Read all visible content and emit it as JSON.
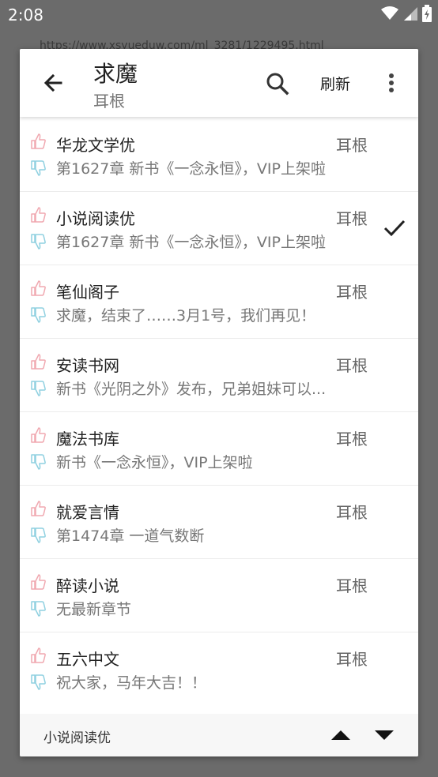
{
  "status_bar": {
    "time": "2:08"
  },
  "background_url": "https://www.xsyueduw.com/ml_3281/1229495.html",
  "toolbar": {
    "title": "求魔",
    "subtitle": "耳根",
    "refresh_label": "刷新",
    "icons": [
      "back-arrow-icon",
      "search-icon",
      "more-vert-icon"
    ]
  },
  "sources": [
    {
      "name": "华龙文学优",
      "author": "耳根",
      "latest": "第1627章 新书《一念永恒》，VIP上架啦",
      "selected": false
    },
    {
      "name": "小说阅读优",
      "author": "耳根",
      "latest": "第1627章 新书《一念永恒》，VIP上架啦",
      "selected": true
    },
    {
      "name": "笔仙阁子",
      "author": "耳根",
      "latest": "求魔，结束了……3月1号，我们再见！",
      "selected": false
    },
    {
      "name": "安读书网",
      "author": "耳根",
      "latest": "新书《光阴之外》发布，兄弟姐妹可以...",
      "selected": false
    },
    {
      "name": "魔法书库",
      "author": "耳根",
      "latest": "新书《一念永恒》，VIP上架啦",
      "selected": false
    },
    {
      "name": "就爱言情",
      "author": "耳根",
      "latest": "第1474章 一道气数断",
      "selected": false
    },
    {
      "name": "醉读小说",
      "author": "耳根",
      "latest": "无最新章节",
      "selected": false
    },
    {
      "name": "五六中文",
      "author": "耳根",
      "latest": "祝大家，马年大吉！！",
      "selected": false
    }
  ],
  "footer": {
    "current_source": "小说阅读优"
  },
  "colors": {
    "thumb_up": "#f0a8b0",
    "thumb_down": "#8fd0e0",
    "background_dim": "#6b6b6b"
  }
}
